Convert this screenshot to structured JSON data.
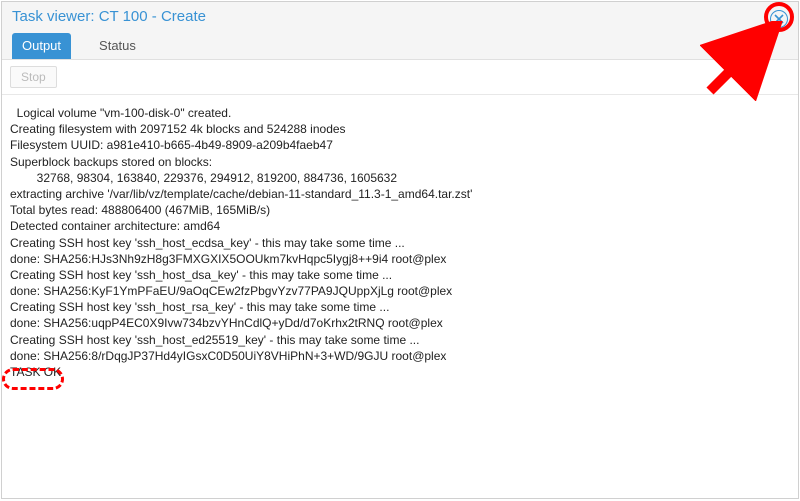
{
  "window": {
    "title": "Task viewer: CT 100 - Create"
  },
  "tabs": {
    "output": "Output",
    "status": "Status"
  },
  "toolbar": {
    "stop_label": "Stop"
  },
  "log": {
    "lines": [
      "  Logical volume \"vm-100-disk-0\" created.",
      "Creating filesystem with 2097152 4k blocks and 524288 inodes",
      "Filesystem UUID: a981e410-b665-4b49-8909-a209b4faeb47",
      "Superblock backups stored on blocks:",
      "        32768, 98304, 163840, 229376, 294912, 819200, 884736, 1605632",
      "extracting archive '/var/lib/vz/template/cache/debian-11-standard_11.3-1_amd64.tar.zst'",
      "Total bytes read: 488806400 (467MiB, 165MiB/s)",
      "Detected container architecture: amd64",
      "Creating SSH host key 'ssh_host_ecdsa_key' - this may take some time ...",
      "done: SHA256:HJs3Nh9zH8g3FMXGXIX5OOUkm7kvHqpc5Iygj8++9i4 root@plex",
      "Creating SSH host key 'ssh_host_dsa_key' - this may take some time ...",
      "done: SHA256:KyF1YmPFaEU/9aOqCEw2fzPbgvYzv77PA9JQUppXjLg root@plex",
      "Creating SSH host key 'ssh_host_rsa_key' - this may take some time ...",
      "done: SHA256:uqpP4EC0X9Ivw734bzvYHnCdlQ+yDd/d7oKrhx2tRNQ root@plex",
      "Creating SSH host key 'ssh_host_ed25519_key' - this may take some time ...",
      "done: SHA256:8/rDqgJP37Hd4yIGsxC0D50UiY8VHiPhN+3+WD/9GJU root@plex",
      "TASK OK"
    ]
  },
  "colors": {
    "accent": "#3892d4",
    "annotation": "#ff0000"
  }
}
